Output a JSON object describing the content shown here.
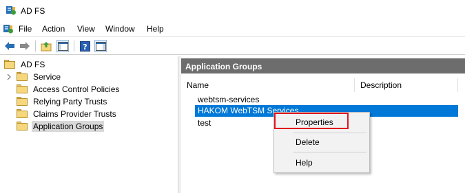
{
  "window": {
    "title": "AD FS"
  },
  "menu": {
    "items": [
      "File",
      "Action",
      "View",
      "Window",
      "Help"
    ]
  },
  "toolbar": {
    "buttons": [
      "back-icon",
      "forward-icon",
      "up-folder-icon",
      "show-hide-tree-icon",
      "help-icon",
      "show-hide-action-pane-icon"
    ]
  },
  "tree": {
    "root": "AD FS",
    "items": [
      "Service",
      "Access Control Policies",
      "Relying Party Trusts",
      "Claims Provider Trusts",
      "Application Groups"
    ],
    "selected": "Application Groups"
  },
  "content": {
    "header": "Application Groups",
    "columns": [
      "Name",
      "Description"
    ],
    "rows": [
      "webtsm-services",
      "HAKOM WebTSM Services",
      "test"
    ],
    "selected_row": "HAKOM WebTSM Services"
  },
  "context_menu": {
    "items": [
      "Properties",
      "Delete",
      "Help"
    ],
    "highlighted": "Properties"
  },
  "colors": {
    "selection": "#0078d7",
    "header_bg": "#6d6d6d",
    "highlight_border": "#e0141e",
    "folder": "#f6d77c"
  }
}
